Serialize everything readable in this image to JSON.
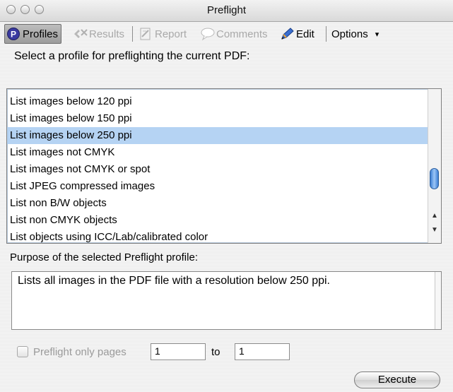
{
  "window": {
    "title": "Preflight"
  },
  "toolbar": {
    "profiles": "Profiles",
    "results": "Results",
    "report": "Report",
    "comments": "Comments",
    "edit": "Edit",
    "options": "Options",
    "options_arrow": "▾"
  },
  "prompt": "Select a profile for preflighting the current PDF:",
  "profiles_list": [
    {
      "label": "List images below 120 ppi",
      "selected": false
    },
    {
      "label": "List images below 150 ppi",
      "selected": false
    },
    {
      "label": "List images below 250 ppi",
      "selected": true
    },
    {
      "label": "List images not CMYK",
      "selected": false
    },
    {
      "label": "List images not CMYK or spot",
      "selected": false
    },
    {
      "label": "List JPEG compressed images",
      "selected": false
    },
    {
      "label": "List non B/W objects",
      "selected": false
    },
    {
      "label": "List non CMYK objects",
      "selected": false
    },
    {
      "label": "List objects using ICC/Lab/calibrated color",
      "selected": false
    }
  ],
  "purpose": {
    "label": "Purpose of the selected Preflight profile:",
    "text": "Lists all images in the PDF file with a resolution below 250 ppi."
  },
  "pages": {
    "label": "Preflight only pages",
    "from": "1",
    "to_label": "to",
    "to": "1"
  },
  "execute": "Execute",
  "colors": {
    "selection": "#b5d3f3",
    "scroll_thumb": "#3c7ed4"
  }
}
